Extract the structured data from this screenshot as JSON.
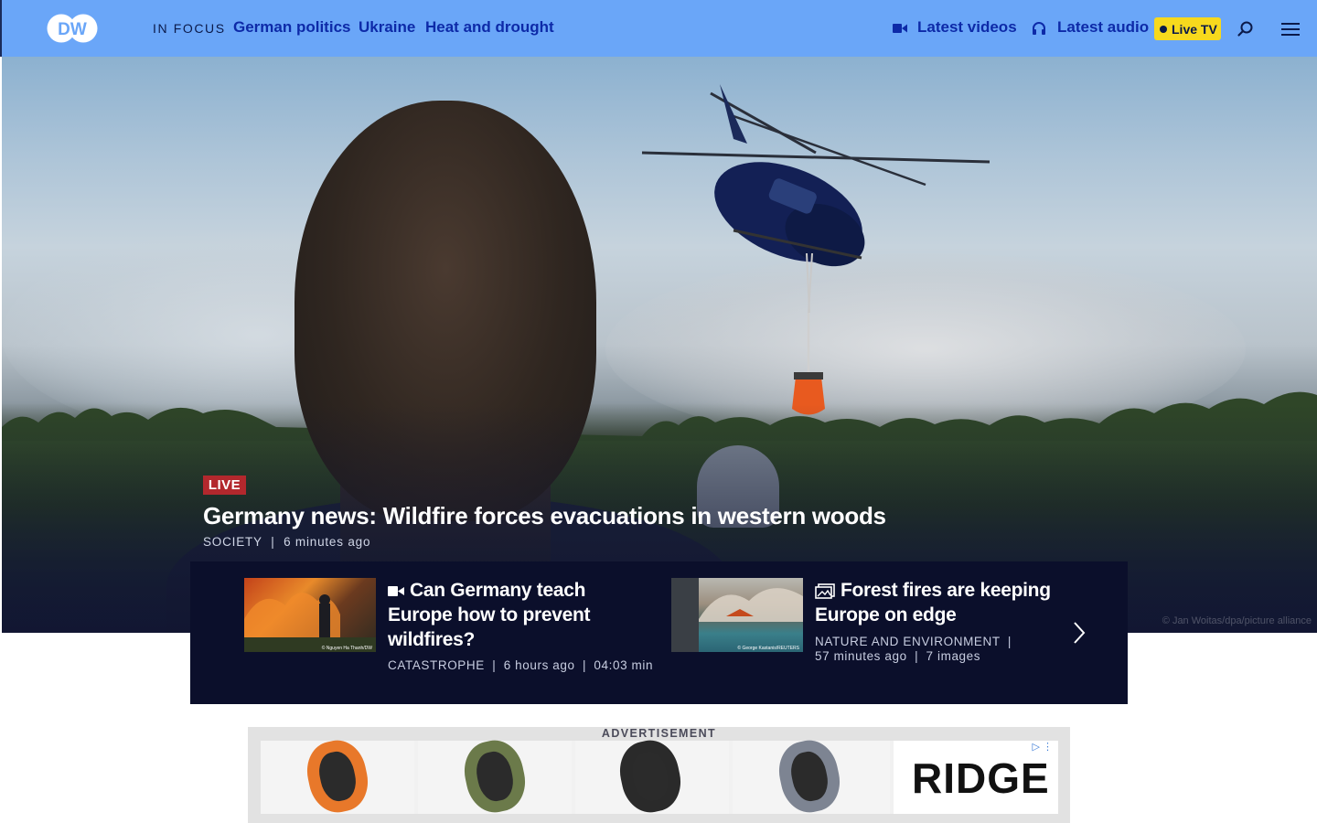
{
  "header": {
    "logo": "DW",
    "in_focus_label": "IN FOCUS",
    "focus_links": [
      "German politics",
      "Ukraine",
      "Heat and drought"
    ],
    "latest_videos_label": "Latest videos",
    "latest_audio_label": "Latest audio",
    "live_tv_label": "Live TV",
    "icons": {
      "videos": "video-camera-icon",
      "audio": "headphones-icon",
      "search": "search-icon",
      "menu": "hamburger-menu-icon"
    }
  },
  "hero": {
    "badge": "LIVE",
    "headline": "Germany news: Wildfire forces evacuations in western woods",
    "category": "SOCIETY",
    "separator": "|",
    "time": "6 minutes ago",
    "credit": "© Jan Woitas/dpa/picture alliance"
  },
  "stories": [
    {
      "icon": "video-camera-icon",
      "title": "Can Germany teach Europe how to prevent wildfires?",
      "category": "CATASTROPHE",
      "time": "6 hours ago",
      "duration": "04:03 min",
      "image_credit": "© Nguyen Ha Thanh/DW"
    },
    {
      "icon": "gallery-icon",
      "title": "Forest fires are keeping Europe on edge",
      "category": "NATURE AND ENVIRONMENT",
      "time": "57 minutes ago",
      "count": "7 images",
      "image_credit": "© George Kastanis/REUTERS"
    }
  ],
  "ad": {
    "label": "ADVERTISEMENT",
    "brand": "RIDGE",
    "ring_colors": [
      "#e8782a",
      "#6b7a4a",
      "#2a2a2a",
      "#7d8492"
    ]
  },
  "colors": {
    "header_bg": "#6aa6f8",
    "nav_link": "#0d2aa8",
    "live_badge": "#b3282d",
    "live_tv_bg": "#f7d91d",
    "strip_bg": "#0b0f2b"
  }
}
